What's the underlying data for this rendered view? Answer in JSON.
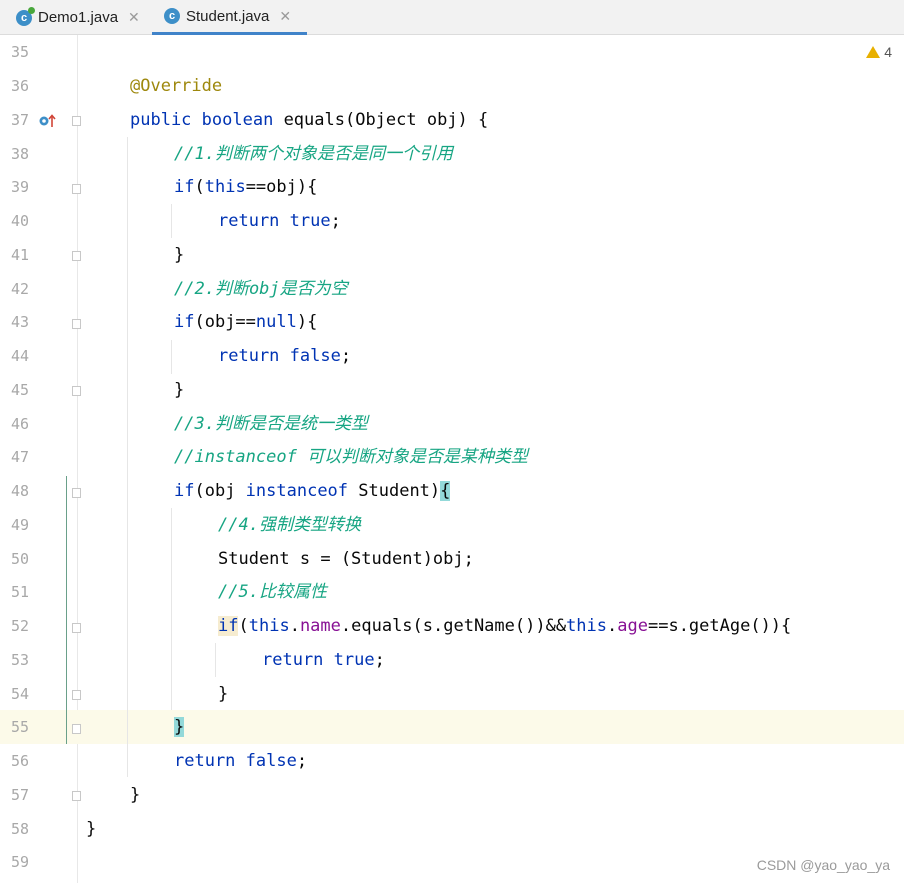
{
  "tabs": [
    {
      "label": "Demo1.java",
      "icon": "java-class-icon",
      "active": false
    },
    {
      "label": "Student.java",
      "icon": "java-class-icon",
      "active": true
    }
  ],
  "editor": {
    "warning_count": "4",
    "watermark": "CSDN @yao_yao_ya",
    "current_line": "55",
    "lines": [
      {
        "num": "35"
      },
      {
        "num": "36"
      },
      {
        "num": "37"
      },
      {
        "num": "38"
      },
      {
        "num": "39"
      },
      {
        "num": "40"
      },
      {
        "num": "41"
      },
      {
        "num": "42"
      },
      {
        "num": "43"
      },
      {
        "num": "44"
      },
      {
        "num": "45"
      },
      {
        "num": "46"
      },
      {
        "num": "47"
      },
      {
        "num": "48"
      },
      {
        "num": "49"
      },
      {
        "num": "50"
      },
      {
        "num": "51"
      },
      {
        "num": "52"
      },
      {
        "num": "53"
      },
      {
        "num": "54"
      },
      {
        "num": "55"
      },
      {
        "num": "56"
      },
      {
        "num": "57"
      },
      {
        "num": "58"
      },
      {
        "num": "59"
      }
    ],
    "code": {
      "l36": {
        "annotation": "@Override"
      },
      "l37": {
        "kw1": "public",
        "kw2": "boolean",
        "rest": " equals(Object obj) {"
      },
      "l38": {
        "comment": "//1.判断两个对象是否是同一个引用"
      },
      "l39": {
        "kw": "if",
        "p1": "(",
        "kw2": "this",
        "rest": "==obj){"
      },
      "l40": {
        "kw": "return",
        "kw2": "true",
        "rest": ";"
      },
      "l41": {
        "text": "}"
      },
      "l42": {
        "comment": "//2.判断obj是否为空"
      },
      "l43": {
        "kw": "if",
        "p1": "(obj==",
        "kw2": "null",
        "rest": "){"
      },
      "l44": {
        "kw": "return",
        "kw2": "false",
        "rest": ";"
      },
      "l45": {
        "text": "}"
      },
      "l46": {
        "comment": "//3.判断是否是统一类型"
      },
      "l47": {
        "comment": "//instanceof 可以判断对象是否是某种类型"
      },
      "l48": {
        "kw": "if",
        "p1": "(obj ",
        "kw2": "instanceof",
        "p2": " Student)",
        "brace": "{"
      },
      "l49": {
        "comment": "//4.强制类型转换"
      },
      "l50": {
        "text": "Student s = (Student)obj;"
      },
      "l51": {
        "comment": "//5.比较属性"
      },
      "l52": {
        "kw": "if",
        "p1": "(",
        "this1": "this",
        "dot1": ".",
        "f1": "name",
        "p2": ".equals(s.getName())&&",
        "this2": "this",
        "dot2": ".",
        "f2": "age",
        "p3": "==s.getAge()){"
      },
      "l53": {
        "kw": "return",
        "kw2": "true",
        "rest": ";"
      },
      "l54": {
        "text": "}"
      },
      "l55": {
        "brace": "}"
      },
      "l56": {
        "kw": "return",
        "kw2": "false",
        "rest": ";"
      },
      "l57": {
        "text": "}"
      },
      "l58": {
        "text": "}"
      }
    }
  }
}
